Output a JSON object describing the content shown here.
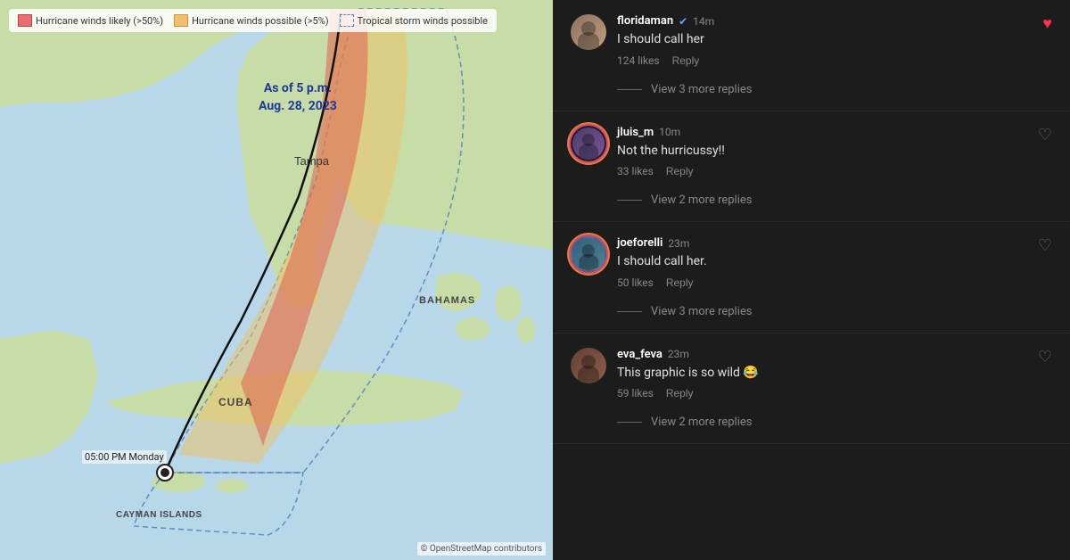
{
  "map": {
    "date_line1": "As of 5 p.m.",
    "date_line2": "Aug. 28, 2023",
    "time_label": "05:00 PM Monday",
    "attribution": "© OpenStreetMap contributors",
    "legend": [
      {
        "id": "likely",
        "color": "red",
        "label": "Hurricane winds likely (>50%)"
      },
      {
        "id": "possible",
        "color": "orange",
        "label": "Hurricane winds possible (>5%)"
      },
      {
        "id": "tropical",
        "color": "dotted",
        "label": "Tropical storm winds possible"
      }
    ],
    "places": [
      {
        "name": "Tampa",
        "x": "55%",
        "y": "29%"
      },
      {
        "name": "BAHAMAS",
        "x": "77%",
        "y": "52%"
      },
      {
        "name": "CUBA",
        "x": "55%",
        "y": "68%"
      },
      {
        "name": "CAYMAN ISLANDS",
        "x": "40%",
        "y": "88%"
      }
    ]
  },
  "comments": [
    {
      "id": "floridaman",
      "username": "floridaman",
      "verified": true,
      "timestamp": "14m",
      "text": "I should call her",
      "likes": "124 likes",
      "has_heart": true,
      "replies_count": "View 3 more replies"
    },
    {
      "id": "jluis_m",
      "username": "jluis_m",
      "verified": false,
      "timestamp": "10m",
      "text": "Not the hurricussy!!",
      "likes": "33 likes",
      "has_heart": false,
      "replies_count": "View 2 more replies"
    },
    {
      "id": "joeforelli",
      "username": "joeforelli",
      "verified": false,
      "timestamp": "23m",
      "text": "I should call her.",
      "likes": "50 likes",
      "has_heart": false,
      "replies_count": "View 3 more replies"
    },
    {
      "id": "eva_feva",
      "username": "eva_feva",
      "verified": false,
      "timestamp": "23m",
      "text": "This graphic is so wild 😂",
      "likes": "59 likes",
      "has_heart": false,
      "replies_count": "View 2 more replies"
    }
  ],
  "labels": {
    "reply": "Reply",
    "view_replies_prefix": "View",
    "view_replies_suffix": "more replies"
  }
}
